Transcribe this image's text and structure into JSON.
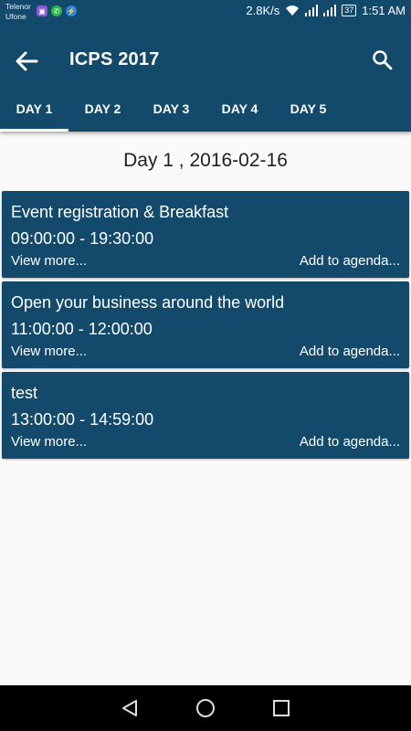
{
  "status_bar": {
    "carrier_1": "Telenor",
    "carrier_2": "Ufone",
    "net_speed": "2.8K/s",
    "battery": "37",
    "time": "1:51 AM",
    "icons": [
      "gallery-app-icon",
      "whatsapp-icon",
      "messenger-icon",
      "wifi-icon",
      "signal-icon",
      "signal-icon",
      "battery-icon"
    ]
  },
  "app_bar": {
    "title": "ICPS 2017",
    "back_icon": "arrow-left-icon",
    "search_icon": "search-icon",
    "color": "#134a6b"
  },
  "tabs": [
    {
      "label": "DAY 1",
      "active": true
    },
    {
      "label": "DAY 2",
      "active": false
    },
    {
      "label": "DAY 3",
      "active": false
    },
    {
      "label": "DAY 4",
      "active": false
    },
    {
      "label": "DAY 5",
      "active": false
    }
  ],
  "day_heading": "Day 1 , 2016-02-16",
  "events": [
    {
      "title": "Event registration & Breakfast",
      "time": "09:00:00 - 19:30:00",
      "more": "View more...",
      "add": "Add to agenda..."
    },
    {
      "title": "Open your business around the world",
      "time": "11:00:00 - 12:00:00",
      "more": "View more...",
      "add": "Add to agenda..."
    },
    {
      "title": "test",
      "time": "13:00:00 - 14:59:00",
      "more": "View more...",
      "add": "Add to agenda..."
    }
  ],
  "nav_bar": {
    "icons": [
      "back-triangle-icon",
      "home-circle-icon",
      "recents-square-icon"
    ]
  }
}
